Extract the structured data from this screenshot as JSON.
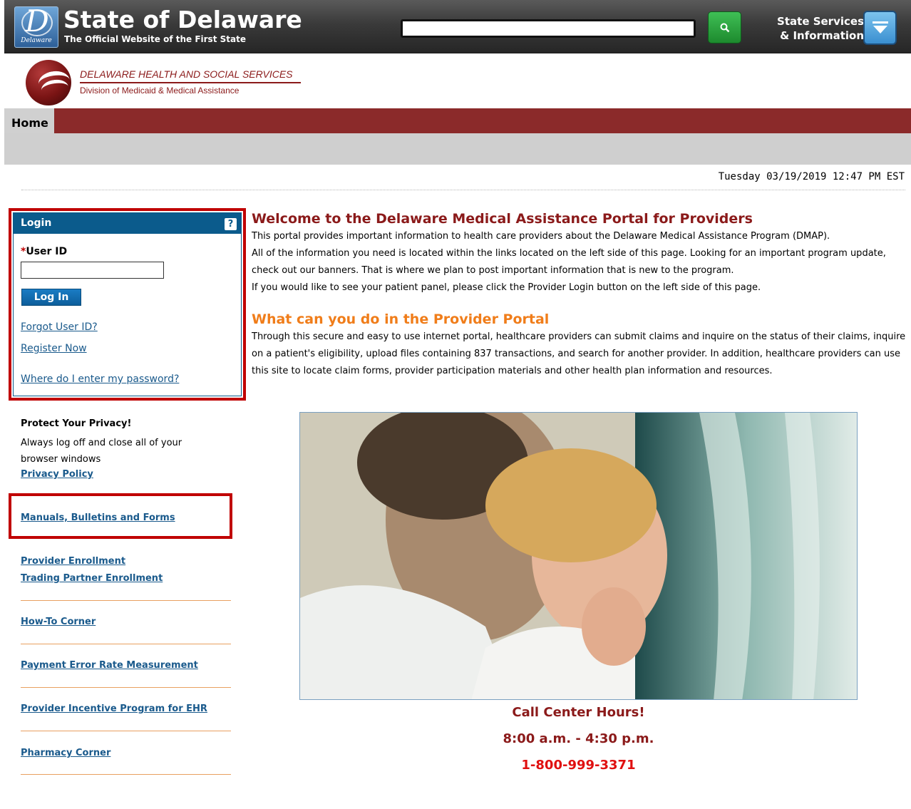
{
  "header": {
    "title": "State of Delaware",
    "tagline": "The Official Website of the First State",
    "seal_text": "Delaware",
    "services_line1": "State Services",
    "services_line2": "& Information",
    "search_placeholder": ""
  },
  "agency": {
    "name": "DELAWARE HEALTH AND SOCIAL SERVICES",
    "division": "Division of Medicaid & Medical Assistance"
  },
  "nav": {
    "home": "Home"
  },
  "datetime": "Tuesday 03/19/2019 12:47 PM EST",
  "login": {
    "title": "Login",
    "help": "?",
    "required_mark": "*",
    "userid_label": "User ID",
    "userid_value": "",
    "button": "Log In",
    "forgot": "Forgot User ID?",
    "register": "Register Now",
    "password_help": "Where do I enter my password?"
  },
  "privacy": {
    "title": "Protect Your Privacy!",
    "text": "Always log off and close all of your browser windows",
    "link": "Privacy Policy"
  },
  "sidebar": {
    "manuals": "Manuals, Bulletins and Forms",
    "provider_enrollment": "Provider Enrollment",
    "trading_partner": "Trading Partner Enrollment",
    "howto": "How-To Corner",
    "perm": "Payment Error Rate Measurement",
    "incentive": "Provider Incentive Program for EHR",
    "pharmacy": "Pharmacy Corner"
  },
  "main": {
    "welcome_heading": "Welcome to the Delaware Medical Assistance Portal for Providers",
    "welcome_p1": "This portal provides important information to health care providers about the Delaware Medical Assistance Program (DMAP).",
    "welcome_p2": "All of the information you need is located within the links located on the left side of this page. Looking for an important program update, check out our banners. That is where we plan to post important information that is new to the program.",
    "welcome_p3": "If you would like to see your patient panel, please click the Provider Login button on the left side of this page.",
    "what_heading": "What can you do in the Provider Portal",
    "what_text": "Through this secure and easy to use internet portal, healthcare providers can submit claims and inquire on the status of their claims, inquire on a patient's eligibility, upload files containing 837 transactions, and search for another provider. In addition, healthcare providers can use this site to locate claim forms, provider participation materials and other health plan information and resources."
  },
  "call_center": {
    "title": "Call Center Hours!",
    "hours": "8:00 a.m. - 4:30 p.m.",
    "phone": "1-800-999-3371"
  },
  "colors": {
    "maroon": "#8b1a1a",
    "nav_maroon": "#8b2a2a",
    "login_blue": "#0b5b8c",
    "link_blue": "#1a5a8c",
    "orange": "#f07d1a",
    "highlight_red": "#c00000",
    "phone_red": "#e01010"
  },
  "icons": [
    "delaware-seal-icon",
    "search-icon",
    "chevron-down-icon",
    "help-icon",
    "dhss-logo-icon"
  ]
}
